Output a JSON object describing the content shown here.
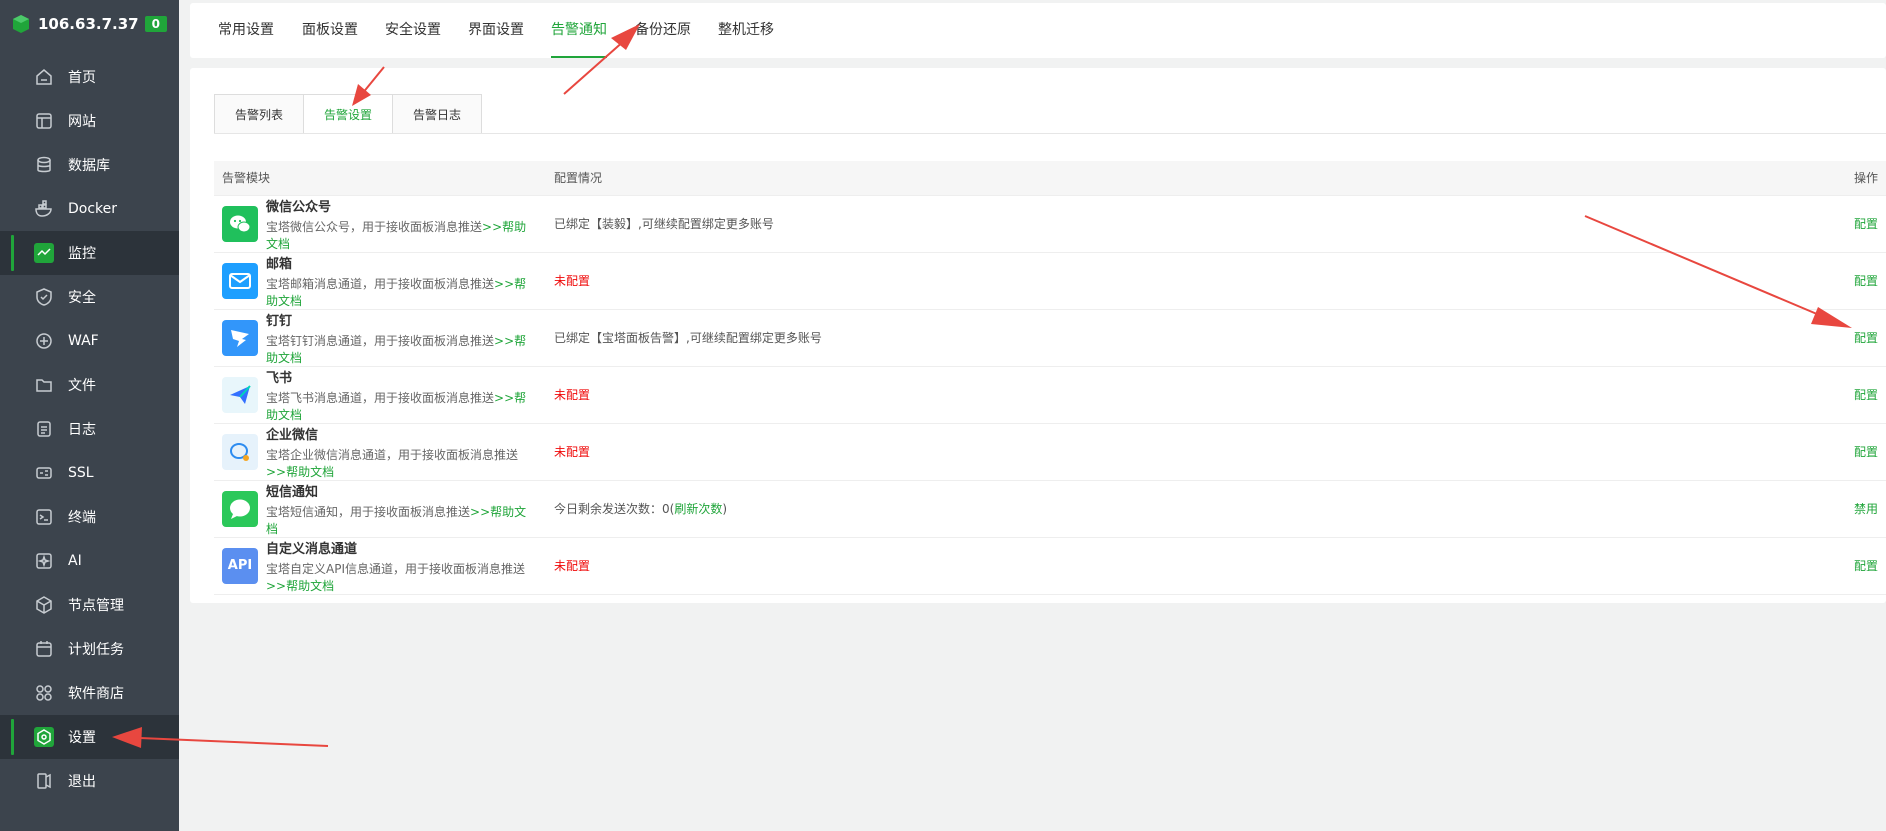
{
  "brand": {
    "ip": "106.63.7.37",
    "badge": "0"
  },
  "sidebar": {
    "items": [
      {
        "label": "首页",
        "icon": "home-icon"
      },
      {
        "label": "网站",
        "icon": "website-icon"
      },
      {
        "label": "数据库",
        "icon": "database-icon"
      },
      {
        "label": "Docker",
        "icon": "docker-icon"
      },
      {
        "label": "监控",
        "icon": "monitor-icon"
      },
      {
        "label": "安全",
        "icon": "shield-icon"
      },
      {
        "label": "WAF",
        "icon": "waf-icon"
      },
      {
        "label": "文件",
        "icon": "folder-icon"
      },
      {
        "label": "日志",
        "icon": "log-icon"
      },
      {
        "label": "SSL",
        "icon": "ssl-icon"
      },
      {
        "label": "终端",
        "icon": "terminal-icon"
      },
      {
        "label": "AI",
        "icon": "ai-icon"
      },
      {
        "label": "节点管理",
        "icon": "node-icon"
      },
      {
        "label": "计划任务",
        "icon": "calendar-icon"
      },
      {
        "label": "软件商店",
        "icon": "store-icon"
      },
      {
        "label": "设置",
        "icon": "settings-icon"
      },
      {
        "label": "退出",
        "icon": "logout-icon"
      }
    ]
  },
  "top_tabs": [
    "常用设置",
    "面板设置",
    "安全设置",
    "界面设置",
    "告警通知",
    "备份还原",
    "整机迁移"
  ],
  "sub_tabs": [
    "告警列表",
    "告警设置",
    "告警日志"
  ],
  "table": {
    "headers": {
      "module": "告警模块",
      "config": "配置情况",
      "op": "操作"
    },
    "help_text": ">>帮助文档",
    "rows": [
      {
        "name": "微信公众号",
        "desc": "宝塔微信公众号，用于接收面板消息推送",
        "config": "已绑定【装毅】,可继续配置绑定更多账号",
        "config_type": "normal",
        "op": "配置",
        "icon": "wechat-icon",
        "color": "#20c05c"
      },
      {
        "name": "邮箱",
        "desc": "宝塔邮箱消息通道，用于接收面板消息推送",
        "config": "未配置",
        "config_type": "red",
        "op": "配置",
        "icon": "mail-icon",
        "color": "#1e9fff"
      },
      {
        "name": "钉钉",
        "desc": "宝塔钉钉消息通道，用于接收面板消息推送",
        "config": "已绑定【宝塔面板告警】,可继续配置绑定更多账号",
        "config_type": "normal",
        "op": "配置",
        "icon": "dingtalk-icon",
        "color": "#3296fa"
      },
      {
        "name": "飞书",
        "desc": "宝塔飞书消息通道，用于接收面板消息推送",
        "config": "未配置",
        "config_type": "red",
        "op": "配置",
        "icon": "feishu-icon",
        "color": "#e8f6fb"
      },
      {
        "name": "企业微信",
        "desc": "宝塔企业微信消息通道，用于接收面板消息推送",
        "config": "未配置",
        "config_type": "red",
        "op": "配置",
        "icon": "wecom-icon",
        "color": "#e6f2fb"
      },
      {
        "name": "短信通知",
        "desc": "宝塔短信通知，用于接收面板消息推送",
        "config": "今日剩余发送次数：0(",
        "config_type": "sms",
        "refresh": "刷新次数",
        "config_end": ")",
        "op": "禁用",
        "icon": "sms-icon",
        "color": "#2bc85a"
      },
      {
        "name": "自定义消息通道",
        "desc": "宝塔自定义API信息通道，用于接收面板消息推送",
        "config": "未配置",
        "config_type": "red",
        "op": "配置",
        "icon": "api-icon",
        "icon_text": "API",
        "color": "#5b8ff0"
      }
    ]
  },
  "colors": {
    "accent": "#20a53a",
    "sidebar": "#3c444d",
    "warn": "#ef0808",
    "arrow": "#e8473f"
  }
}
